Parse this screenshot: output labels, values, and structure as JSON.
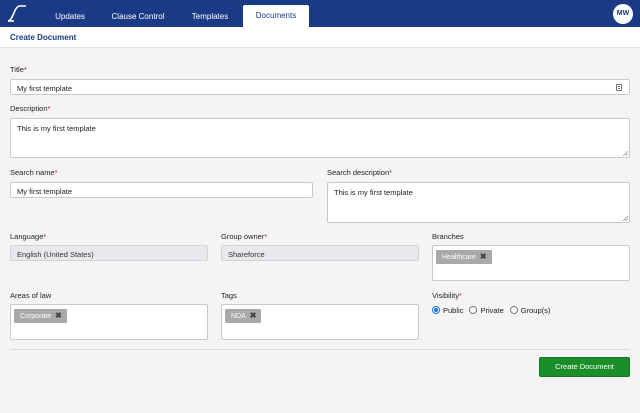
{
  "nav": {
    "tabs": [
      {
        "label": "Updates"
      },
      {
        "label": "Clause Control"
      },
      {
        "label": "Templates"
      },
      {
        "label": "Documents"
      }
    ],
    "avatar_initials": "MW"
  },
  "page": {
    "title": "Create Document"
  },
  "form": {
    "title": {
      "label": "Title",
      "value": "My first template"
    },
    "description": {
      "label": "Description",
      "value": "This is my first template"
    },
    "search_name": {
      "label": "Search name",
      "value": "My first template"
    },
    "search_description": {
      "label": "Search description",
      "value": "This is my first template"
    },
    "language": {
      "label": "Language",
      "value": "English (United States)"
    },
    "group_owner": {
      "label": "Group owner",
      "value": "Shareforce"
    },
    "branches": {
      "label": "Branches",
      "chips": [
        "Healthcare"
      ]
    },
    "areas_of_law": {
      "label": "Areas of law",
      "chips": [
        "Corporate"
      ]
    },
    "tags": {
      "label": "Tags",
      "chips": [
        "NDA"
      ]
    },
    "visibility": {
      "label": "Visibility",
      "options": [
        "Public",
        "Private",
        "Group(s)"
      ],
      "selected": "Public"
    },
    "required_marker": "*",
    "remove_glyph": "✖"
  },
  "actions": {
    "create_label": "Create Document"
  },
  "colors": {
    "nav_bg": "#1b3a86",
    "accent_green": "#1b8e2a",
    "required_red": "#c0172a"
  }
}
